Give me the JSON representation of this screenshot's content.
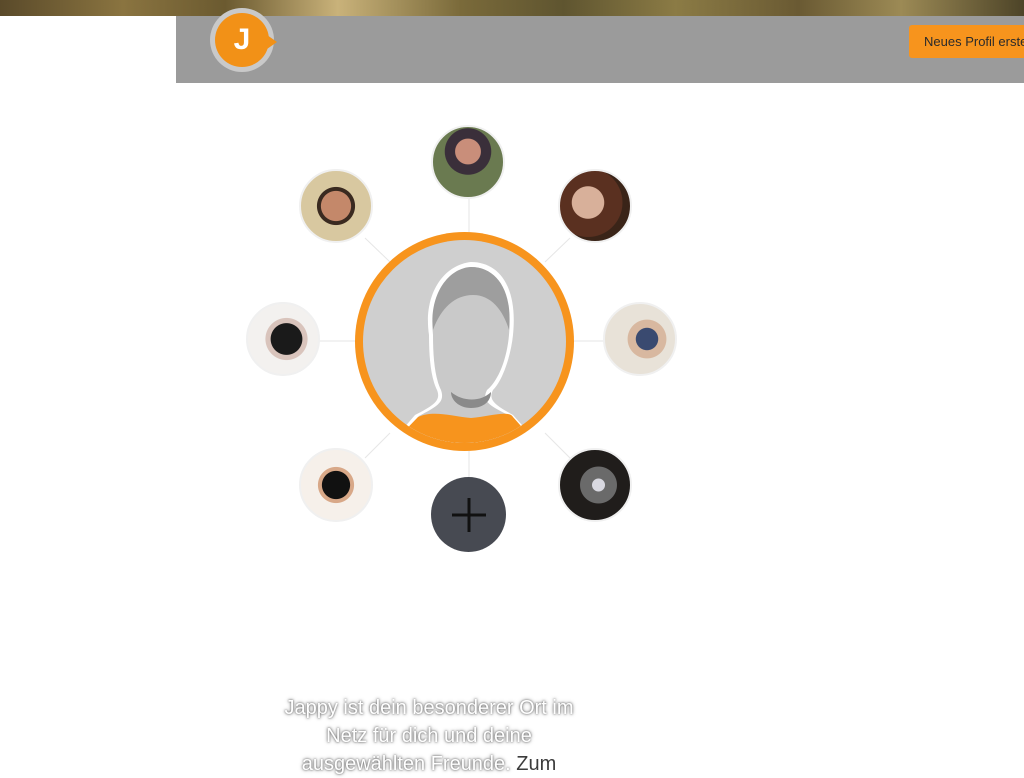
{
  "header": {
    "logo_letter": "J",
    "cta_label": "Neues Profil erste"
  },
  "network": {
    "friends": [
      {
        "id": "friend-top"
      },
      {
        "id": "friend-top-left"
      },
      {
        "id": "friend-top-right"
      },
      {
        "id": "friend-left"
      },
      {
        "id": "friend-right"
      },
      {
        "id": "friend-bottom-left"
      },
      {
        "id": "friend-bottom-right"
      }
    ],
    "add_symbol": "+"
  },
  "tagline": {
    "line1": "Jappy ist dein besonderer Ort im",
    "line2": "Netz für dich und deine",
    "line3_a": "ausgewählten Freunde. ",
    "line3_b": "Zum"
  },
  "colors": {
    "accent": "#f7941d",
    "header_bg": "#9b9b9b",
    "add_button_bg": "#474a52"
  }
}
